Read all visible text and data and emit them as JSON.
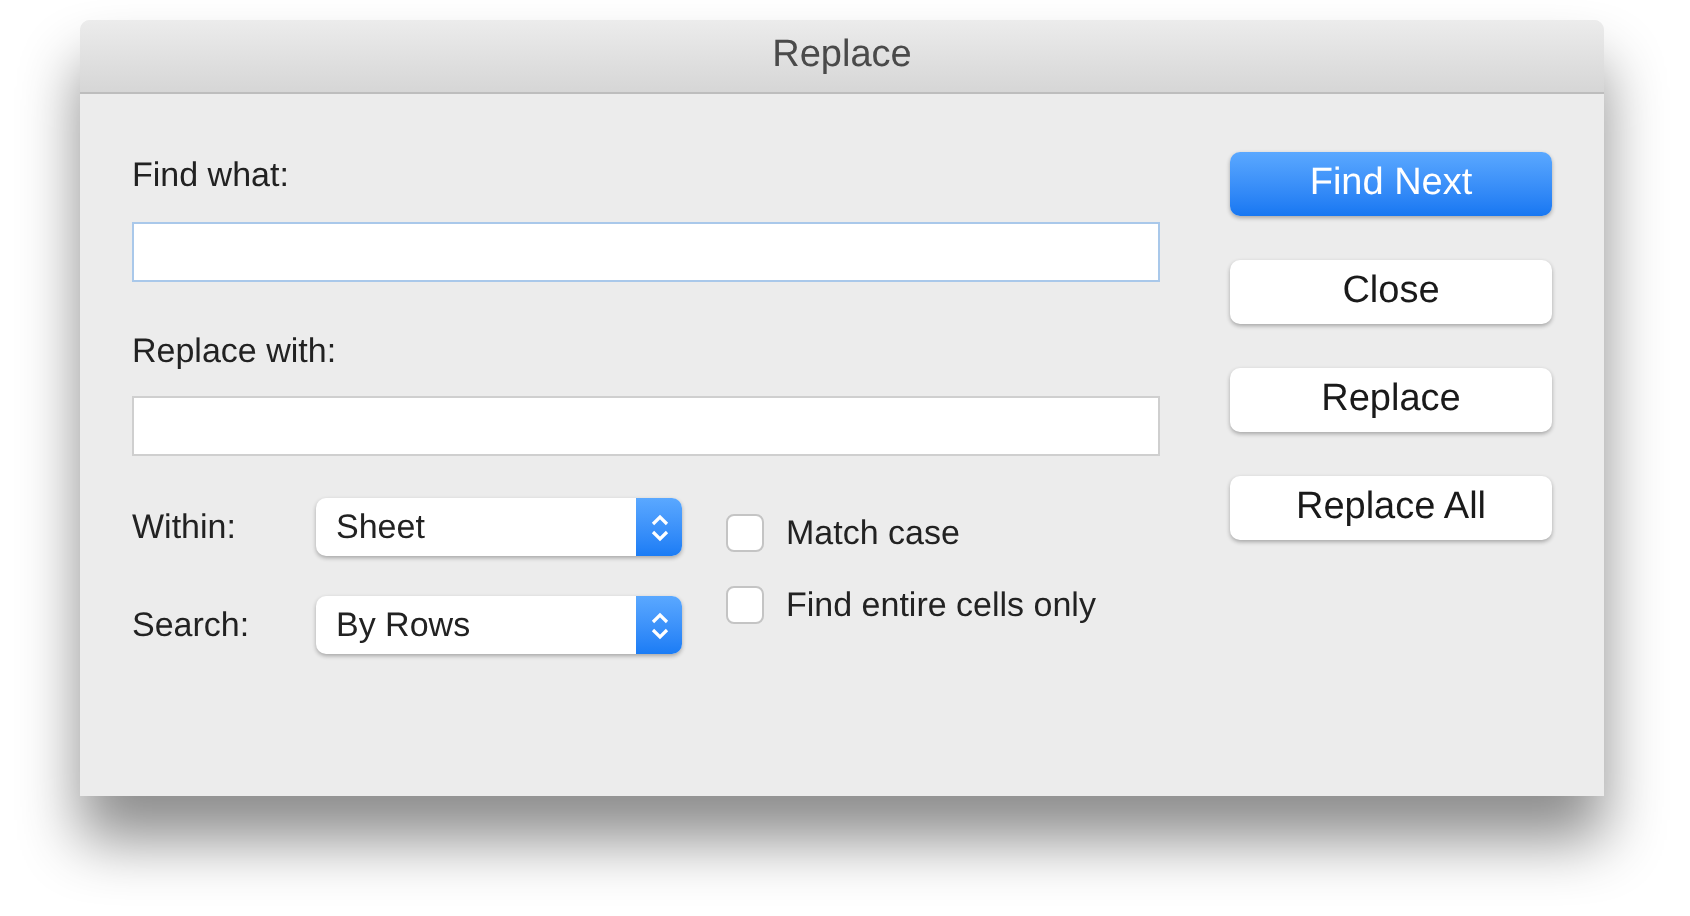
{
  "window": {
    "title": "Replace"
  },
  "fields": [
    {
      "label": "Find what:",
      "focused": true
    },
    {
      "label": "Replace with:",
      "focused": false
    }
  ],
  "selects": [
    {
      "label": "Within:",
      "value": "Sheet"
    },
    {
      "label": "Search:",
      "value": "By Rows"
    }
  ],
  "checkboxes": [
    {
      "label": "Match case",
      "checked": false
    },
    {
      "label": "Find entire cells only",
      "checked": false
    }
  ],
  "buttons": [
    {
      "label": "Find Next",
      "kind": "default"
    },
    {
      "label": "Close",
      "kind": "normal"
    },
    {
      "label": "Replace",
      "kind": "normal"
    },
    {
      "label": "Replace All",
      "kind": "normal"
    }
  ]
}
